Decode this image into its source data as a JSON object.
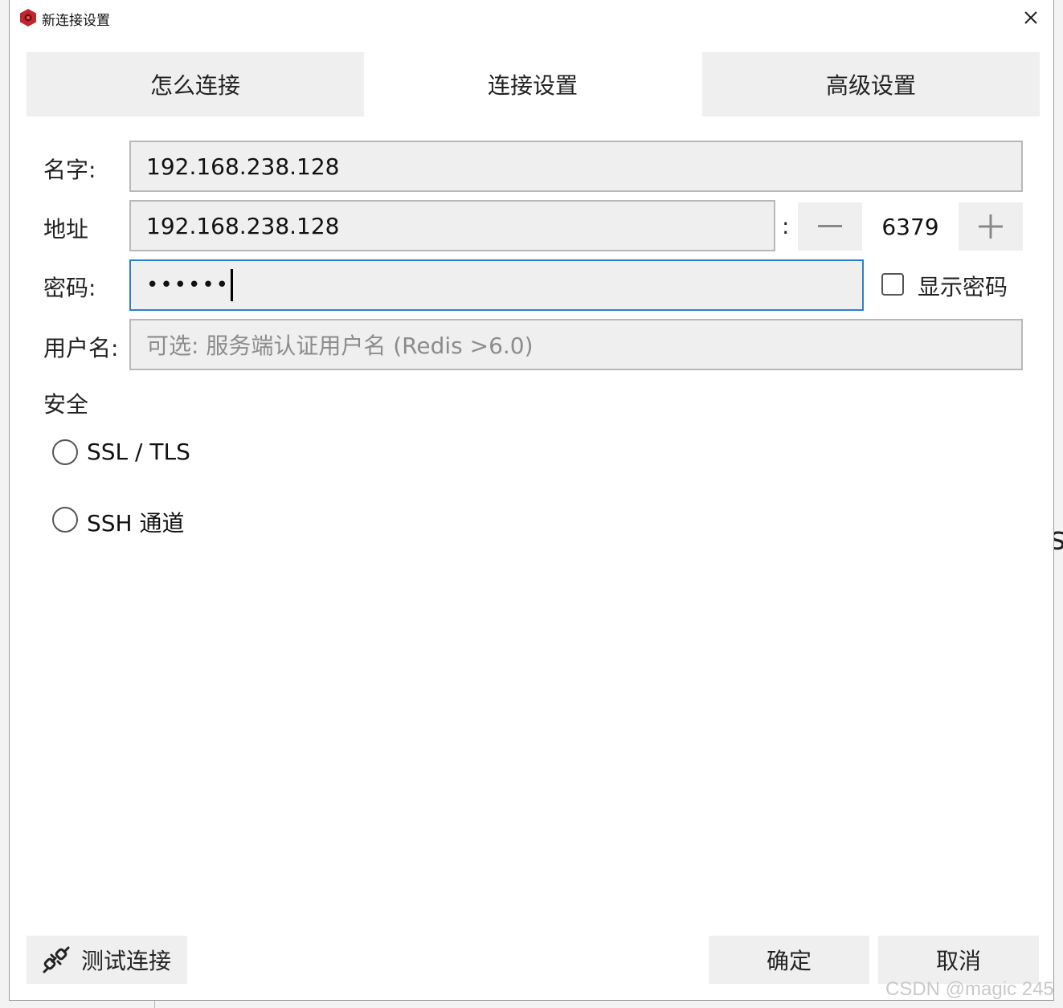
{
  "window": {
    "title": "新连接设置"
  },
  "tabs": [
    {
      "label": "怎么连接",
      "active": false
    },
    {
      "label": "连接设置",
      "active": true
    },
    {
      "label": "高级设置",
      "active": false
    }
  ],
  "form": {
    "name_label": "名字:",
    "name_value": "192.168.238.128",
    "address_label": "地址",
    "address_value": "192.168.238.128",
    "port_separator": ":",
    "port_value": "6379",
    "password_label": "密码:",
    "password_value": "••••••",
    "show_password_label": "显示密码",
    "show_password_checked": false,
    "username_label": "用户名:",
    "username_placeholder": "可选: 服务端认证用户名 (Redis >6.0)"
  },
  "security": {
    "heading": "安全",
    "options": [
      {
        "label": "SSL / TLS",
        "selected": false
      },
      {
        "label": "SSH 通道",
        "selected": false
      }
    ]
  },
  "buttons": {
    "test_connection": "测试连接",
    "ok": "确定",
    "cancel": "取消"
  },
  "watermark": "CSDN @magic 245",
  "icons": {
    "app": "redis-app-icon",
    "close": "close-icon",
    "minus": "minus-icon",
    "plus": "plus-icon",
    "test": "plug-icon"
  },
  "colors": {
    "focus_border": "#2f7fc6",
    "app_icon": "#c0272d"
  }
}
